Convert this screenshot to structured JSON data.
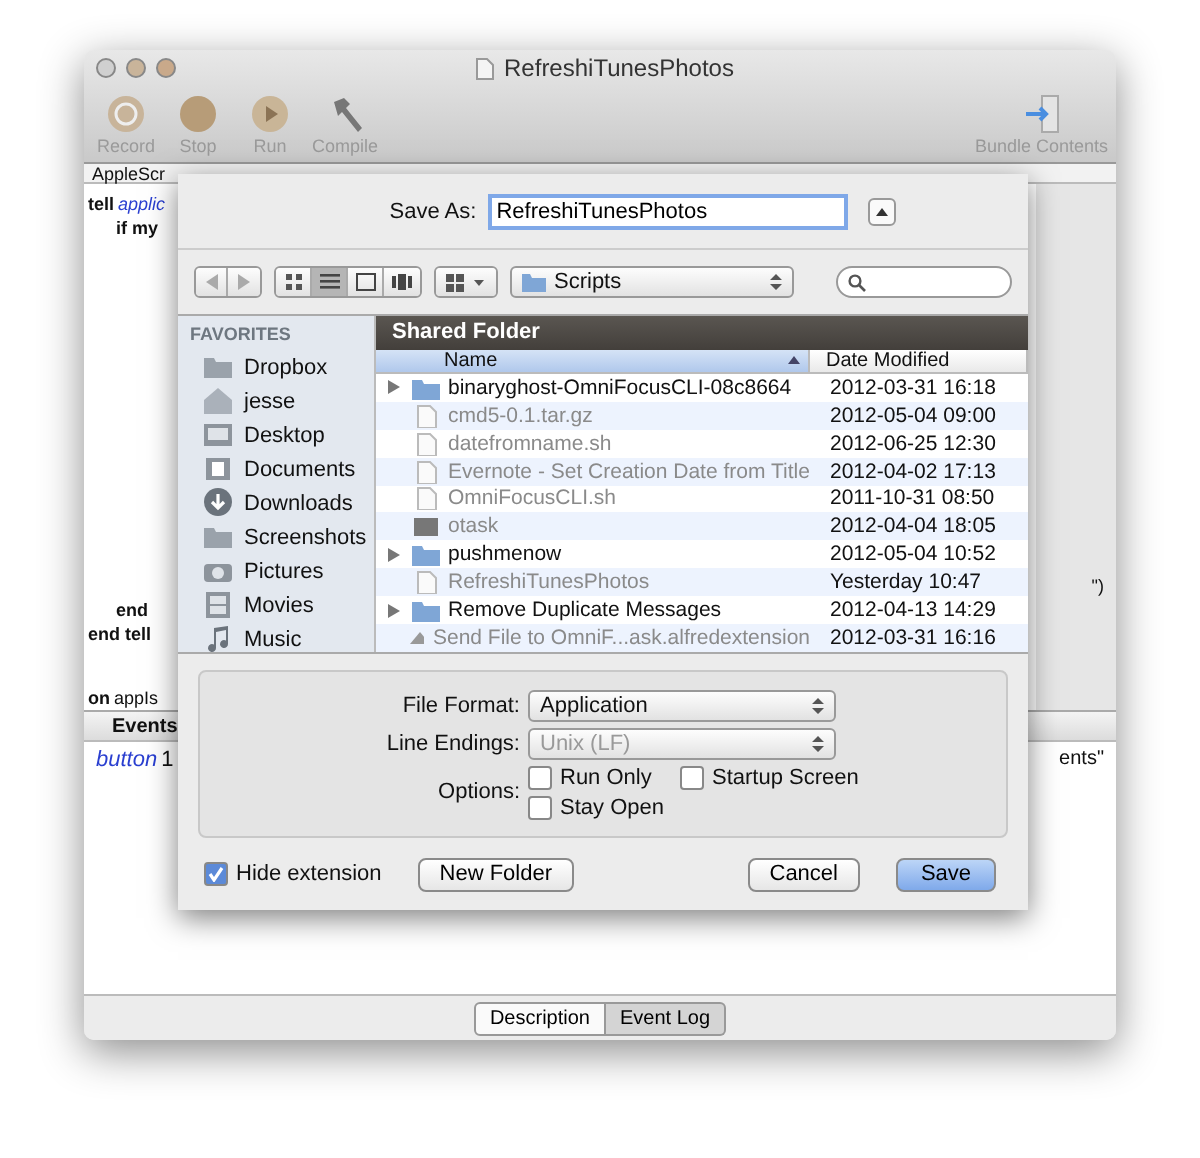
{
  "window": {
    "title": "RefreshiTunesPhotos"
  },
  "toolbar": {
    "buttons": [
      {
        "label": "Record",
        "kind": "record"
      },
      {
        "label": "Stop",
        "kind": "stop"
      },
      {
        "label": "Run",
        "kind": "run"
      },
      {
        "label": "Compile",
        "kind": "compile"
      }
    ],
    "bundle_button": {
      "label": "Bundle Contents"
    }
  },
  "editor": {
    "tab": "AppleScr",
    "top_lines": [
      {
        "segments": [
          {
            "text": "tell",
            "kind": "keyword"
          },
          {
            "text": "applic",
            "kind": "class"
          }
        ],
        "indented": false
      },
      {
        "segments": [
          {
            "text": "if my",
            "kind": "keyword"
          }
        ],
        "indented": true
      }
    ],
    "bottom_lines": [
      {
        "segments": [
          {
            "text": "\")",
            "kind": "plain"
          }
        ],
        "indented": false,
        "right": true
      },
      {
        "segments": [
          {
            "text": "end",
            "kind": "keyword"
          }
        ],
        "indented": true,
        "right": false
      },
      {
        "segments": [
          {
            "text": "end tell",
            "kind": "keyword"
          }
        ],
        "indented": false,
        "right": false
      }
    ],
    "handler_line": {
      "segments": [
        {
          "text": "on",
          "kind": "keyword"
        },
        {
          "text": "appIs",
          "kind": "plain"
        }
      ]
    }
  },
  "log_pane": {
    "tab": "Events",
    "line": [
      {
        "text": "button",
        "kind": "class"
      },
      {
        "text": "1",
        "kind": "plain"
      }
    ],
    "line_end": "ents\""
  },
  "bottom_tabs": [
    {
      "label": "Description",
      "selected": true
    },
    {
      "label": "Event Log",
      "selected": false
    }
  ],
  "sheet": {
    "save_as": {
      "label": "Save As:",
      "value": "RefreshiTunesPhotos"
    },
    "view_modes": [
      {
        "kind": "icons",
        "selected": false
      },
      {
        "kind": "list",
        "selected": true
      },
      {
        "kind": "columns",
        "selected": false
      },
      {
        "kind": "coverflow",
        "selected": false
      }
    ],
    "location": "Scripts",
    "sidebar": {
      "heading": "FAVORITES",
      "items": [
        {
          "label": "Dropbox",
          "kind": "folder"
        },
        {
          "label": "jesse",
          "kind": "home"
        },
        {
          "label": "Desktop",
          "kind": "desktop"
        },
        {
          "label": "Documents",
          "kind": "documents"
        },
        {
          "label": "Downloads",
          "kind": "downloads"
        },
        {
          "label": "Screenshots",
          "kind": "folder"
        },
        {
          "label": "Pictures",
          "kind": "pictures"
        },
        {
          "label": "Movies",
          "kind": "movies"
        },
        {
          "label": "Music",
          "kind": "music"
        }
      ]
    },
    "file_list": {
      "title": "Shared Folder",
      "columns": [
        {
          "label": "Name",
          "sorted": true
        },
        {
          "label": "Date Modified",
          "sorted": false
        }
      ],
      "rows": [
        {
          "name": "binaryghost-OmniFocusCLI-08c8664",
          "date": "2012-03-31 16:18",
          "kind": "folder",
          "expandable": true,
          "dimmed": false
        },
        {
          "name": "cmd5-0.1.tar.gz",
          "date": "2012-05-04 09:00",
          "kind": "archive",
          "expandable": false,
          "dimmed": true
        },
        {
          "name": "datefromname.sh",
          "date": "2012-06-25 12:30",
          "kind": "file",
          "expandable": false,
          "dimmed": true
        },
        {
          "name": "Evernote - Set Creation Date from Title",
          "date": "2012-04-02 17:13",
          "kind": "script",
          "expandable": false,
          "dimmed": true
        },
        {
          "name": "OmniFocusCLI.sh",
          "date": "2011-10-31 08:50",
          "kind": "file",
          "expandable": false,
          "dimmed": true
        },
        {
          "name": "otask",
          "date": "2012-04-04 18:05",
          "kind": "executable",
          "expandable": false,
          "dimmed": true
        },
        {
          "name": "pushmenow",
          "date": "2012-05-04 10:52",
          "kind": "folder",
          "expandable": true,
          "dimmed": false
        },
        {
          "name": "RefreshiTunesPhotos",
          "date": "Yesterday 10:47",
          "kind": "script",
          "expandable": false,
          "dimmed": true
        },
        {
          "name": "Remove Duplicate Messages",
          "date": "2012-04-13 14:29",
          "kind": "folder",
          "expandable": true,
          "dimmed": false
        },
        {
          "name": "Send File to OmniF...ask.alfredextension",
          "date": "2012-03-31 16:16",
          "kind": "extension",
          "expandable": false,
          "dimmed": true
        }
      ]
    },
    "file_format": {
      "label": "File Format:",
      "value": "Application",
      "disabled": false
    },
    "line_endings": {
      "label": "Line Endings:",
      "value": "Unix (LF)",
      "disabled": true
    },
    "options": {
      "label": "Options:",
      "items": [
        {
          "label": "Run Only",
          "checked": false
        },
        {
          "label": "Startup Screen",
          "checked": false
        },
        {
          "label": "Stay Open",
          "checked": false
        }
      ]
    },
    "hide_extension": {
      "label": "Hide extension",
      "checked": true
    },
    "buttons": [
      {
        "label": "New Folder",
        "kind": "secondary"
      },
      {
        "label": "Cancel",
        "kind": "cancel"
      },
      {
        "label": "Save",
        "kind": "default"
      }
    ]
  }
}
